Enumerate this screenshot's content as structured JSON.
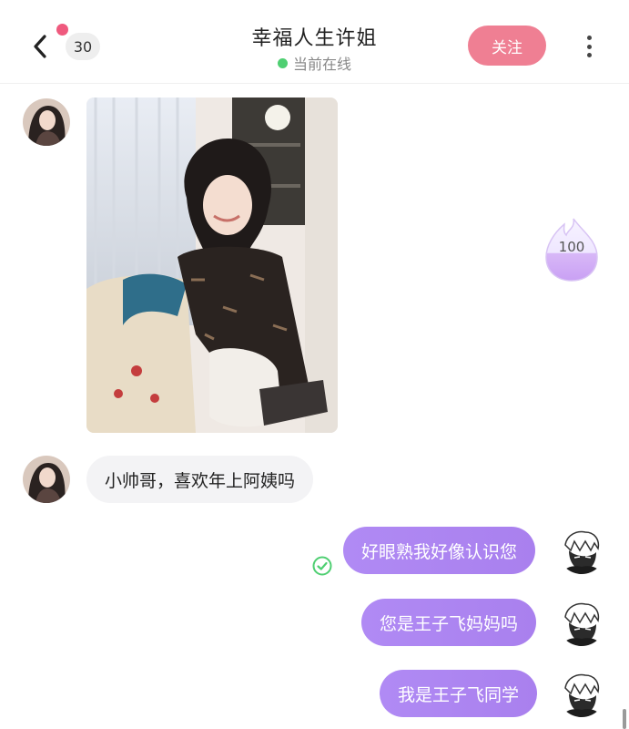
{
  "header": {
    "unread_count": "30",
    "title": "幸福人生许姐",
    "status": "当前在线",
    "follow_label": "关注"
  },
  "heat": {
    "value": "100"
  },
  "messages": [
    {
      "side": "in",
      "type": "image",
      "content": ""
    },
    {
      "side": "in",
      "type": "text",
      "text": "小帅哥，喜欢年上阿姨吗"
    },
    {
      "side": "out",
      "type": "text",
      "text": "好眼熟我好像认识您",
      "read": true
    },
    {
      "side": "out",
      "type": "text",
      "text": "您是王子飞妈妈吗"
    },
    {
      "side": "out",
      "type": "text",
      "text": "我是王子飞同学"
    }
  ],
  "icons": {
    "back": "chevron-left-icon",
    "more": "more-vertical-icon",
    "online": "online-dot-icon",
    "read": "read-check-icon",
    "heat": "flame-icon"
  },
  "colors": {
    "accent_pink": "#ef7f93",
    "unread_dot": "#ef5a7e",
    "online_green": "#4fcf72",
    "outgoing_bubble": "#aa82ef",
    "incoming_bubble": "#f3f3f5"
  }
}
